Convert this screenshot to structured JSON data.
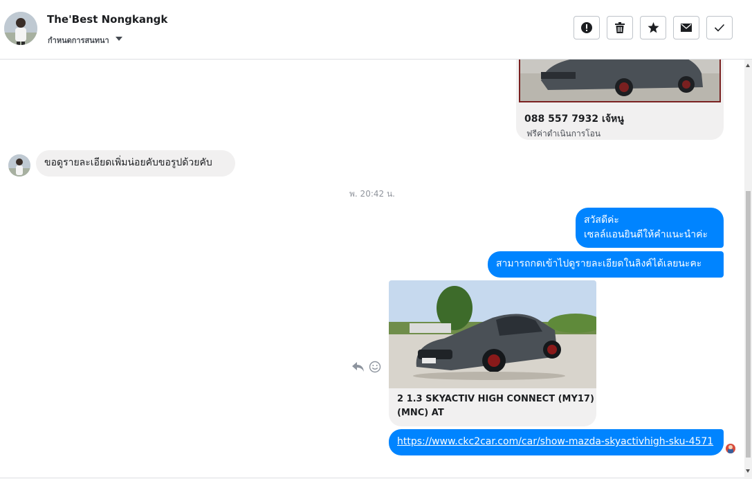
{
  "header": {
    "contact_name": "The'Best Nongkangk",
    "sub_label": "กำหนดการสนทนา",
    "actions": [
      {
        "name": "mark-spam-button",
        "icon": "exclamation-circle-icon"
      },
      {
        "name": "delete-button",
        "icon": "trash-icon"
      },
      {
        "name": "star-button",
        "icon": "star-icon"
      },
      {
        "name": "mark-unread-button",
        "icon": "envelope-icon"
      },
      {
        "name": "mark-done-button",
        "icon": "checkmark-icon"
      }
    ]
  },
  "messages": {
    "top_card": {
      "title": "088 557 7932 เจ้หนู",
      "subtitle": "ฟรีค่าดำเนินการโอน"
    },
    "incoming_1": "ขอดูรายละเอียดเพิ่มน่อยคับขอรูปด้วยคับ",
    "timestamp": "พ. 20:42 น.",
    "outgoing_1_line1": "สวัสดีค่ะ",
    "outgoing_1_line2": "เซลล์แอนยินดีให้คำแนะนำค่ะ",
    "outgoing_2": "สามารถกดเข้าไปดูรายละเอียดในลิงค์ได้เลยนะคะ",
    "car_card_title_line1": "2 1.3 SKYACTIV HIGH CONNECT (MY17)",
    "car_card_title_line2": "(MNC) AT",
    "link": "https://www.ckc2car.com/car/show-mazda-skyactivhigh-sku-4571"
  },
  "icons": {
    "reply": "reply-icon",
    "react": "smiley-icon"
  },
  "colors": {
    "outgoing_bubble": "#0084ff",
    "incoming_bubble": "#f1f0f0",
    "car_body": "#4a5056"
  }
}
